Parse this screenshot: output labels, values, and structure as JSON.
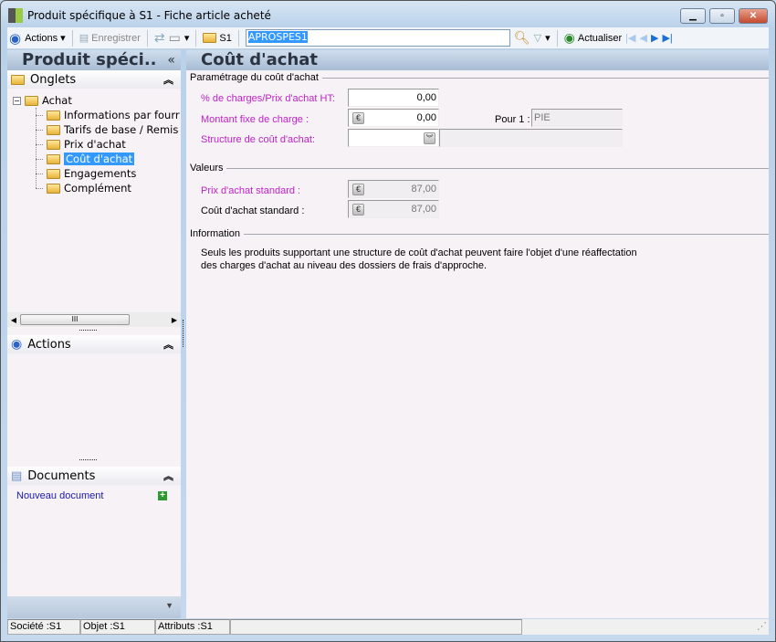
{
  "window": {
    "title": "Produit spécifique à S1 -  Fiche article acheté"
  },
  "toolbar": {
    "actions": "Actions",
    "save": "Enregistrer",
    "folder": "S1",
    "search_value": "APROSPES1",
    "refresh": "Actualiser"
  },
  "left": {
    "header": "Produit spéci..",
    "collapse": "«",
    "onglets": "Onglets",
    "tree_root": "Achat",
    "tree_items": [
      "Informations par fourr",
      "Tarifs de base / Remis",
      "Prix d'achat",
      "Coût d'achat",
      "Engagements",
      "Complément"
    ],
    "scroll_thumb": "III",
    "actions": "Actions",
    "documents": "Documents",
    "new_document": "Nouveau document"
  },
  "main": {
    "header": "Coût d'achat",
    "group1": "Paramétrage du coût d'achat",
    "pct_label": "% de charges/Prix d'achat HT:",
    "pct_value": "0,00",
    "fixed_label": "Montant fixe de charge :",
    "fixed_value": "0,00",
    "per_label": "Pour 1 :",
    "per_value": "PIE",
    "structure_label": "Structure de coût d'achat:",
    "structure_value": "",
    "group2": "Valeurs",
    "std_price_label": "Prix d'achat standard :",
    "std_price_value": "87,00",
    "std_cost_label": "Coût d'achat standard :",
    "std_cost_value": "87,00",
    "group3": "Information",
    "info_line1": "Seuls les produits supportant une structure de coût d'achat peuvent faire l'objet d'une réaffectation",
    "info_line2": "des charges d'achat au niveau des dossiers de frais d'approche."
  },
  "status": {
    "company": "Société :S1",
    "object": "Objet :S1",
    "attributes": "Attributs :S1"
  }
}
